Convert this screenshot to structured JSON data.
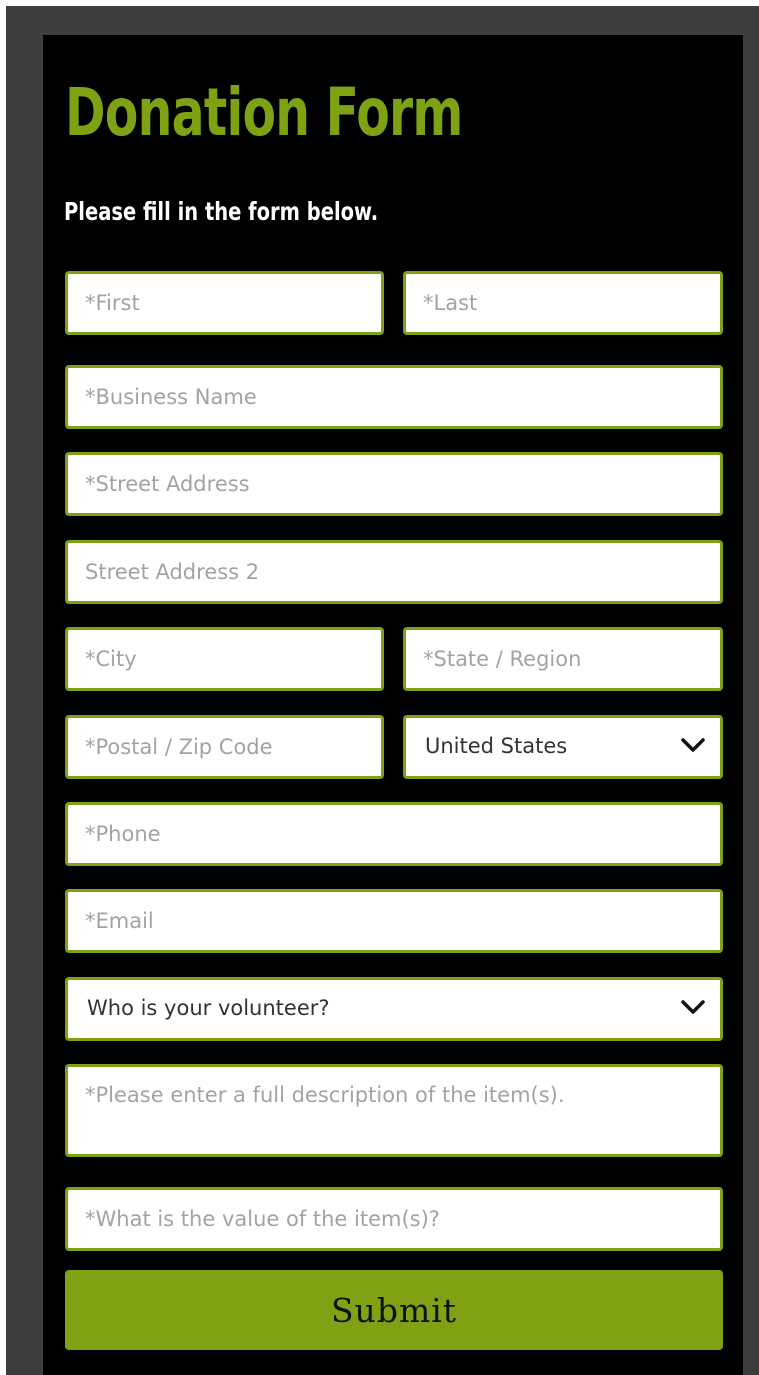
{
  "form": {
    "title": "Donation Form",
    "subtitle": "Please fill in the form below.",
    "fields": {
      "first": {
        "placeholder": "*First",
        "value": ""
      },
      "last": {
        "placeholder": "*Last",
        "value": ""
      },
      "business_name": {
        "placeholder": "*Business Name",
        "value": ""
      },
      "street_address": {
        "placeholder": "*Street Address",
        "value": ""
      },
      "street_address_2": {
        "placeholder": "Street Address 2",
        "value": ""
      },
      "city": {
        "placeholder": "*City",
        "value": ""
      },
      "state": {
        "placeholder": "*State / Region",
        "value": ""
      },
      "postal": {
        "placeholder": "*Postal / Zip Code",
        "value": ""
      },
      "country": {
        "selected": "United States",
        "icon": "chevron-down-icon"
      },
      "phone": {
        "placeholder": "*Phone",
        "value": ""
      },
      "email": {
        "placeholder": "*Email",
        "value": ""
      },
      "volunteer": {
        "selected": "Who is your volunteer?",
        "icon": "chevron-down-icon"
      },
      "description": {
        "placeholder": "*Please enter a full description of the item(s).",
        "value": ""
      },
      "value": {
        "placeholder": "*What is the value of the item(s)?",
        "value": ""
      }
    },
    "submit_label": "Submit"
  },
  "colors": {
    "accent": "#7ea214",
    "panel_background": "#000000",
    "frame_background": "#3e3c3d",
    "placeholder_text": "#a3a3a3",
    "field_background": "#ffffff"
  }
}
